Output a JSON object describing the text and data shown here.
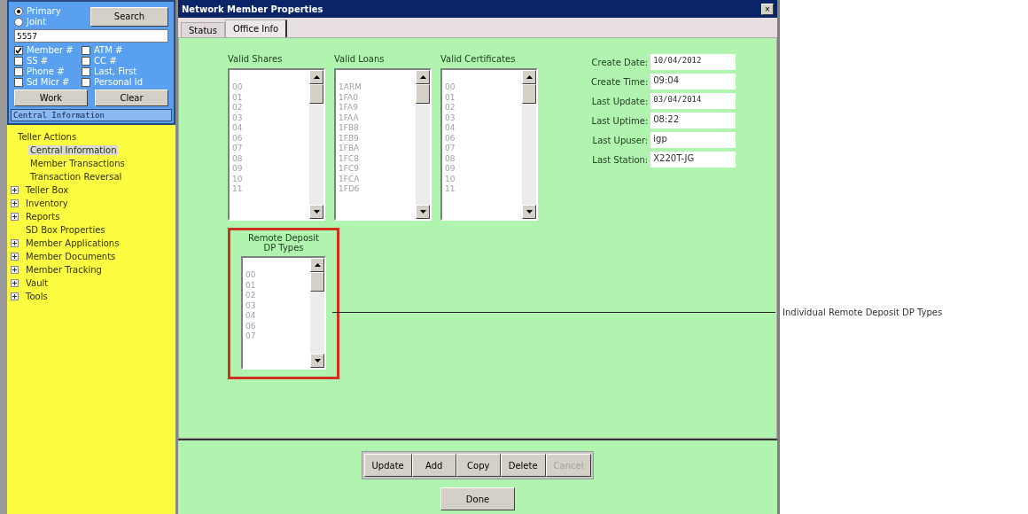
{
  "search_panel": {
    "radios": [
      {
        "label": "Primary",
        "selected": true
      },
      {
        "label": "Joint",
        "selected": false
      }
    ],
    "search_button": "Search",
    "search_value": "5557",
    "checkboxes": [
      {
        "label": "Member #",
        "checked": true
      },
      {
        "label": "ATM #",
        "checked": false
      },
      {
        "label": "SS #",
        "checked": false
      },
      {
        "label": "CC #",
        "checked": false
      },
      {
        "label": "Phone #",
        "checked": false
      },
      {
        "label": "Last, First",
        "checked": false
      },
      {
        "label": "Sd Micr #",
        "checked": false
      },
      {
        "label": "Personal Id",
        "checked": false
      }
    ],
    "buttons": [
      "Work",
      "Clear"
    ],
    "status": "Central Information"
  },
  "tree": [
    {
      "label": "Teller Actions",
      "expanded": true,
      "children": [
        {
          "label": "Central Information",
          "selected": true
        },
        {
          "label": "Member Transactions",
          "selected": false
        },
        {
          "label": "Transaction Reversal",
          "selected": false
        }
      ]
    },
    {
      "label": "Teller Box",
      "expanded": false
    },
    {
      "label": "Inventory",
      "expanded": false
    },
    {
      "label": "Reports",
      "expanded": false
    },
    {
      "label": "SD Box Properties",
      "selected": false
    },
    {
      "label": "Member Applications",
      "expanded": false
    },
    {
      "label": "Member Documents",
      "expanded": false
    },
    {
      "label": "Member Tracking",
      "expanded": false
    },
    {
      "label": "Vault",
      "expanded": false
    },
    {
      "label": "Tools",
      "expanded": false
    }
  ],
  "window": {
    "title": "Network Member Properties",
    "close": "×"
  },
  "tabs": [
    {
      "label": "Status",
      "selected": false
    },
    {
      "label": "Office Info",
      "selected": true
    }
  ],
  "lists": [
    {
      "label": "Valid Shares",
      "items": [
        "00",
        "01",
        "02",
        "03",
        "04",
        "06",
        "07",
        "08",
        "09",
        "10",
        "11"
      ]
    },
    {
      "label": "Valid Loans",
      "items": [
        "1ARM",
        "1FA0",
        "1FA9",
        "1FAA",
        "1FB8",
        "1FB9",
        "1FBA",
        "1FC8",
        "1FC9",
        "1FCA",
        "1FD6"
      ]
    },
    {
      "label": "Valid Certificates",
      "items": [
        "00",
        "01",
        "02",
        "03",
        "04",
        "06",
        "07",
        "08",
        "09",
        "10",
        "11"
      ]
    }
  ],
  "fields": [
    {
      "label": "Create Date:",
      "value": "10/04/2012",
      "kind": "date"
    },
    {
      "label": "Create Time:",
      "value": "09:04",
      "kind": "text"
    },
    {
      "label": "Last Update:",
      "value": "03/04/2014",
      "kind": "date"
    },
    {
      "label": "Last Uptime:",
      "value": "08:22",
      "kind": "text"
    },
    {
      "label": "Last Upuser:",
      "value": "igp",
      "kind": "text"
    },
    {
      "label": "Last Station:",
      "value": "X220T-JG",
      "kind": "text"
    }
  ],
  "remote_deposit": {
    "label": "Remote Deposit DP Types",
    "items": [
      "00",
      "01",
      "02",
      "03",
      "04",
      "06",
      "07"
    ]
  },
  "actions": [
    {
      "label": "Update",
      "disabled": false
    },
    {
      "label": "Add",
      "disabled": false
    },
    {
      "label": "Copy",
      "disabled": false
    },
    {
      "label": "Delete",
      "disabled": false
    },
    {
      "label": "Cancel",
      "disabled": true
    }
  ],
  "done_button": "Done",
  "callout": "Individual Remote Deposit DP Types"
}
